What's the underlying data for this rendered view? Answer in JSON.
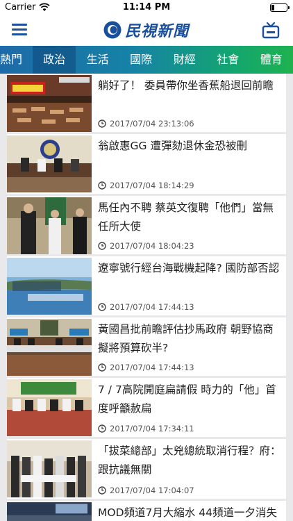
{
  "status": {
    "carrier": "Carrier",
    "time": "11:14 PM"
  },
  "header": {
    "logo_text": "民視新聞"
  },
  "tabs": [
    {
      "label": "熱門",
      "active": false
    },
    {
      "label": "政治",
      "active": true
    },
    {
      "label": "生活",
      "active": false
    },
    {
      "label": "國際",
      "active": false
    },
    {
      "label": "財經",
      "active": false
    },
    {
      "label": "社會",
      "active": false
    },
    {
      "label": "體育",
      "active": false
    }
  ],
  "articles": [
    {
      "title": "躺好了！ 委員帶你坐香蕉船退回前瞻",
      "time": "2017/07/04 23:13:06",
      "thumb": "legislature-protest"
    },
    {
      "title": "翁啟惠GG 遭彈劾退休金恐被刪",
      "time": "2017/07/04 18:14:29",
      "thumb": "control-yuan-press"
    },
    {
      "title": "馬任內不聘 蔡英文復聘「他們」當無任所大使",
      "time": "2017/07/04 18:04:23",
      "thumb": "presidential-ceremony"
    },
    {
      "title": "遼寧號行經台海戰機起降? 國防部否認",
      "time": "2017/07/04 17:44:13",
      "thumb": "coastline-aerial"
    },
    {
      "title": "黃國昌批前瞻評估抄馬政府 朝野協商擬將預算砍半?",
      "time": "2017/07/04 17:44:13",
      "thumb": "negotiation-hall"
    },
    {
      "title": "7 / 7高院開庭扁請假 時力的「他」首度呼籲赦扁",
      "time": "2017/07/04 17:34:11",
      "thumb": "press-conference"
    },
    {
      "title": "「拔菜總部」太兇總統取消行程？府：跟抗議無關",
      "time": "2017/07/04 17:04:07",
      "thumb": "award-group"
    },
    {
      "title": "MOD頻道7月大縮水 44頻道一夕消失",
      "time": "",
      "thumb": "tv-studio"
    }
  ]
}
